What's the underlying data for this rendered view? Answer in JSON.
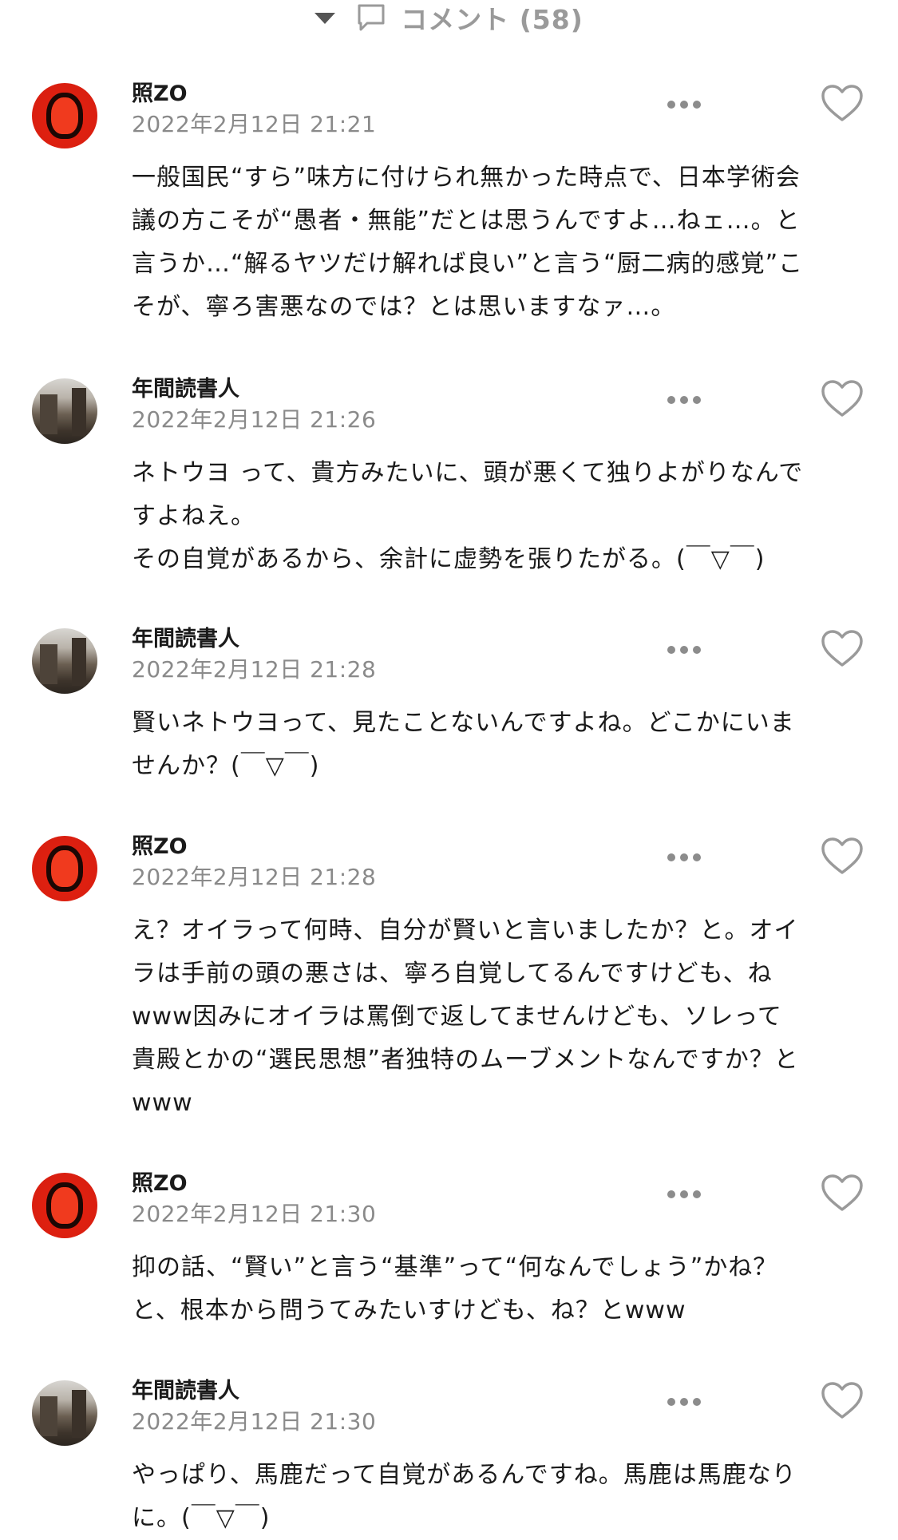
{
  "header": {
    "label": "コメント (58)"
  },
  "comments": [
    {
      "author": "照ZO",
      "date": "2022年2月12日 21:21",
      "text": "一般国民“すら”味方に付けられ無かった時点で、日本学術会\n議の方こそが“愚者・無能”だとは思うんですよ…ねェ…。と\n言うか…“解るヤツだけ解れば良い”と言う“厨二病的感覚”こ\nそが、寧ろ害悪なのでは？とは思いますなァ…。"
    },
    {
      "author": "年間読書人",
      "date": "2022年2月12日 21:26",
      "text": "ネトウヨ って、貴方みたいに、頭が悪くて独りよがりなんで\nすよねえ。\nその自覚があるから、余計に虚勢を張りたがる。(￣▽￣)"
    },
    {
      "author": "年間読書人",
      "date": "2022年2月12日 21:28",
      "text": "賢いネトウヨって、見たことないんですよね。どこかにいま\nせんか？(￣▽￣)"
    },
    {
      "author": "照ZO",
      "date": "2022年2月12日 21:28",
      "text": "え？オイラって何時、自分が賢いと言いましたか？と。オイ\nラは手前の頭の悪さは、寧ろ自覚してるんですけども、ね\nwww因みにオイラは罵倒で返してませんけども、ソレって\n貴殿とかの“選民思想”者独特のムーブメントなんですか？と\nwww"
    },
    {
      "author": "照ZO",
      "date": "2022年2月12日 21:30",
      "text": "抑の話、“賢い”と言う“基準”って“何なんでしょう”かね？\nと、根本から問うてみたいすけども、ね？とwww"
    },
    {
      "author": "年間読書人",
      "date": "2022年2月12日 21:30",
      "text": "やっぱり、馬鹿だって自覚があるんですね。馬鹿は馬鹿なり\nに。(￣▽￣)"
    }
  ]
}
